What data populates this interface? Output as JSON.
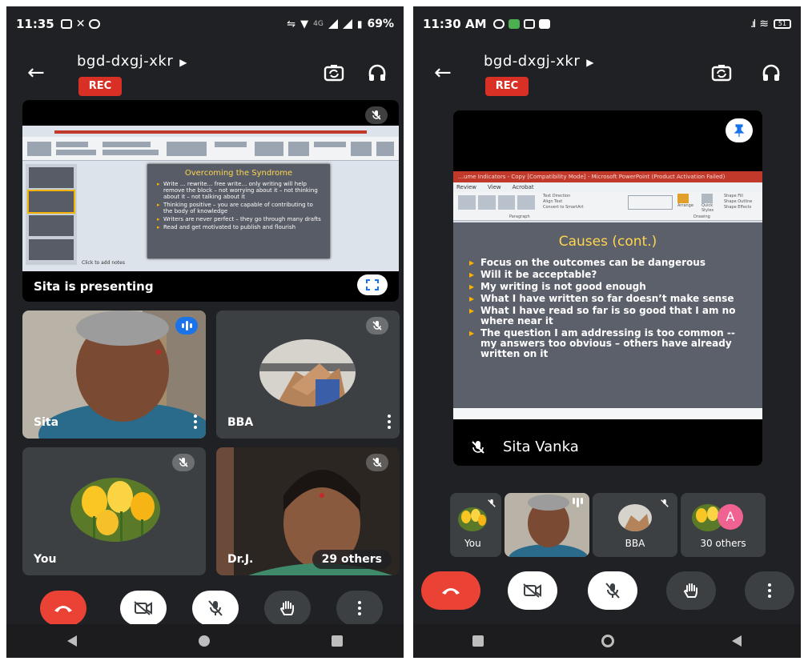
{
  "left": {
    "status": {
      "time": "11:35",
      "network": "4G",
      "battery": "69%"
    },
    "meeting_code": "bgd-dxgj-xkr",
    "rec": "REC",
    "presentation": {
      "banner": "Sita is presenting",
      "slide_title": "Overcoming the Syndrome",
      "bullets": [
        "Write … rewrite… free write… only writing will help remove the block – not worrying about it – not thinking about it – not talking about it",
        "Thinking positive – you are capable of contributing to the body of knowledge",
        "Writers are never perfect – they go through many drafts",
        "Read and get motivated to publish and flourish"
      ],
      "notes_placeholder": "Click to add notes"
    },
    "tiles": {
      "sita": "Sita",
      "bba": "BBA",
      "you": "You",
      "drj": "Dr.J.",
      "others": "29 others"
    }
  },
  "right": {
    "status": {
      "time": "11:30 AM",
      "battery": "51"
    },
    "meeting_code": "bgd-dxgj-xkr",
    "rec": "REC",
    "presentation": {
      "window_title": "…ume Indicators - Copy [Compatibility Mode] - Microsoft PowerPoint (Product Activation Failed)",
      "ribbon_tabs": [
        "Review",
        "View",
        "Acrobat"
      ],
      "ribbon_groups": [
        "Paragraph",
        "Drawing"
      ],
      "ribbon_items": [
        "Text Direction",
        "Align Text",
        "Convert to SmartArt",
        "Arrange",
        "Quick Styles",
        "Shape Fill",
        "Shape Outline",
        "Shape Effects"
      ],
      "slide_title": "Causes (cont.)",
      "bullets": [
        "Focus on the outcomes can be dangerous",
        "Will it be acceptable?",
        "My writing is not good enough",
        "What I have written so far doesn’t make sense",
        "What I have read so far is so good that I am no where near it",
        "The question I am addressing is too common -- my answers too obvious – others have already written on it"
      ],
      "presenter_name": "Sita Vanka"
    },
    "tiles": {
      "you": "You",
      "bba": "BBA",
      "others": "30 others",
      "avatar_letter": "A"
    }
  },
  "colors": {
    "background": "#202124",
    "tile": "#3c4043",
    "end_call": "#ea4335",
    "rec": "#d93025",
    "speaking": "#1a73e8",
    "avatar_a": "#f06292",
    "slide_title": "#ffd54f"
  },
  "icons": [
    "back-arrow-icon",
    "switch-camera-icon",
    "headphones-icon",
    "mic-off-icon",
    "speaking-icon",
    "more-vert-icon",
    "end-call-icon",
    "camera-off-icon",
    "raise-hand-icon",
    "pin-icon",
    "fullscreen-icon"
  ]
}
